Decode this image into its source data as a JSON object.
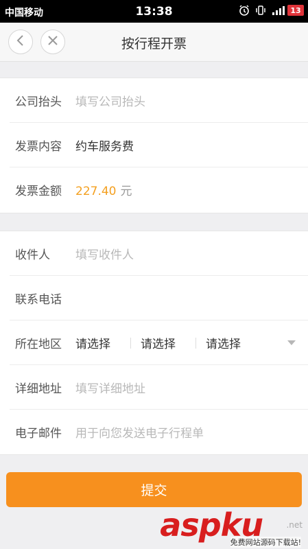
{
  "status_bar": {
    "carrier": "中国移动",
    "time": "13:38",
    "battery": "13"
  },
  "nav": {
    "title": "按行程开票"
  },
  "invoice": {
    "company_label": "公司抬头",
    "company_placeholder": "填写公司抬头",
    "content_label": "发票内容",
    "content_value": "约车服务费",
    "amount_label": "发票金额",
    "amount_value": "227.40",
    "amount_unit": "元"
  },
  "recipient": {
    "name_label": "收件人",
    "name_placeholder": "填写收件人",
    "phone_label": "联系电话",
    "region_label": "所在地区",
    "region_selects": [
      "请选择",
      "请选择",
      "请选择"
    ],
    "address_label": "详细地址",
    "address_placeholder": "填写详细地址",
    "email_label": "电子邮件",
    "email_placeholder": "用于向您发送电子行程单"
  },
  "submit_label": "提交",
  "watermark": {
    "brand": "aspku",
    "suffix": ".net",
    "slogan": "免费网站源码下载站!"
  },
  "colors": {
    "accent": "#f7901e",
    "amount": "#f4a020"
  }
}
